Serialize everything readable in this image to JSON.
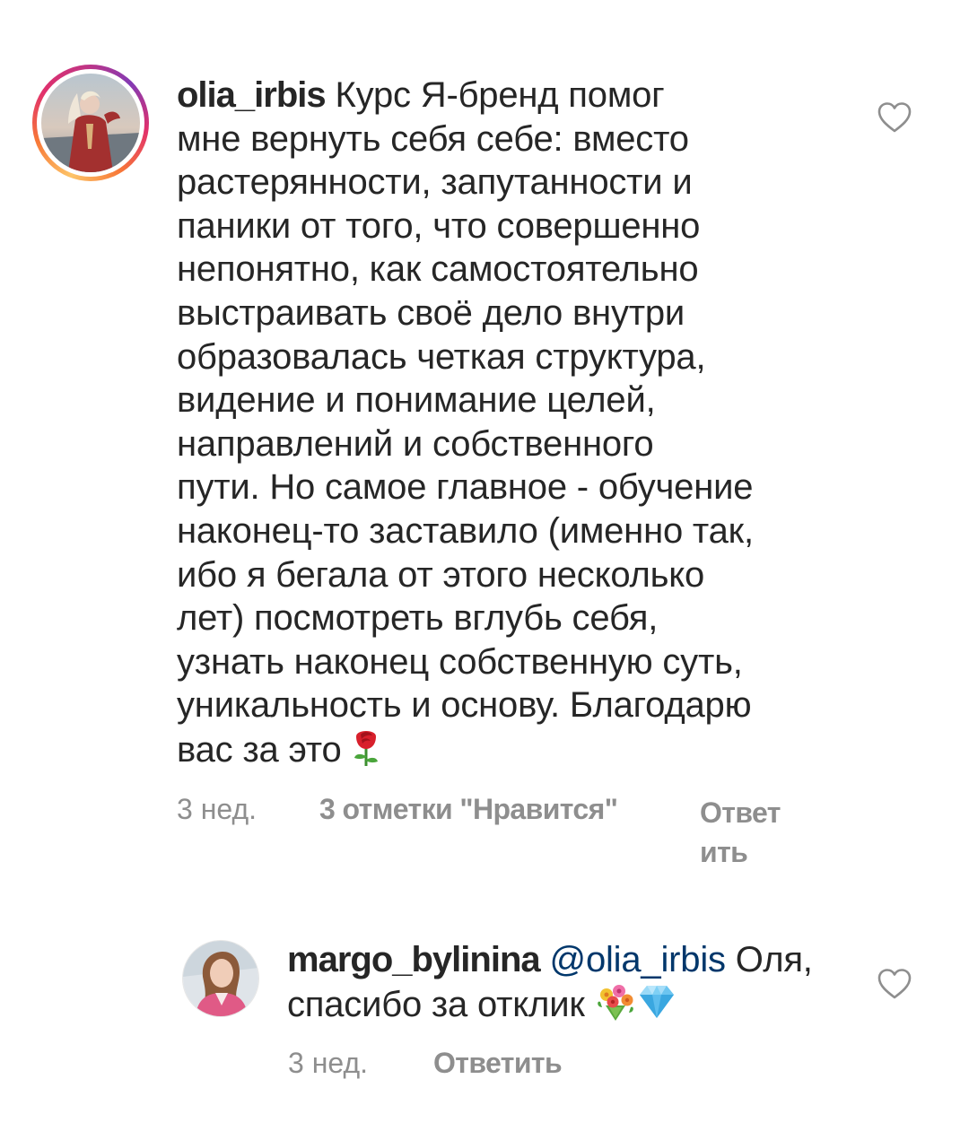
{
  "comments": [
    {
      "username": "olia_irbis",
      "text": "Курс Я-бренд помог мне вернуть себя себе: вместо растерянности, запутанности и паники от того, что совершенно непонятно, как самостоятельно выстраивать своё дело внутри образовалась четкая структура, видение и понимание целей, направлений и собственного пути. Но самое главное - обучение наконец-то заставило (именно так, ибо я бегала от этого несколько лет) посмотреть вглубь себя, узнать наконец собственную суть, уникальность и основу. Благодарю вас за это",
      "text_lines": [
        "мне вернуть себя себе: вместо",
        "растерянности, запутанности и",
        "паники от того, что совершенно",
        "непонятно, как самостоятельно",
        "выстраивать своё дело внутри",
        "образовалась четкая структура,",
        "видение и понимание целей,",
        "направлений и собственного",
        "пути. Но самое главное - обучение",
        "наконец-то заставило (именно так,",
        "ибо я бегала от этого несколько",
        "лет) посмотреть вглубь себя,",
        "узнать наконец собственную суть,",
        "уникальность и основу. Благодарю",
        "вас за это"
      ],
      "first_line_rest": "Курс Я-бренд помог",
      "emoji": [
        "rose-emoji"
      ],
      "time": "3 нед.",
      "likes": "3 отметки \"Нравится\"",
      "reply_line1": "Ответ",
      "reply_line2": "ить",
      "has_story_ring": true
    },
    {
      "username": "margo_bylinina",
      "mention": "@olia_irbis",
      "text_after_mention": "Оля,",
      "second_line": "спасибо за отклик",
      "emoji": [
        "bouquet-emoji",
        "gem-emoji"
      ],
      "time": "3 нед.",
      "reply": "Ответить",
      "has_story_ring": false
    }
  ],
  "icons": {
    "like": "heart-outline-icon"
  },
  "colors": {
    "text": "#262626",
    "secondary": "#8e8e8e",
    "mention": "#00376b",
    "icon": "#8e8e8e"
  }
}
